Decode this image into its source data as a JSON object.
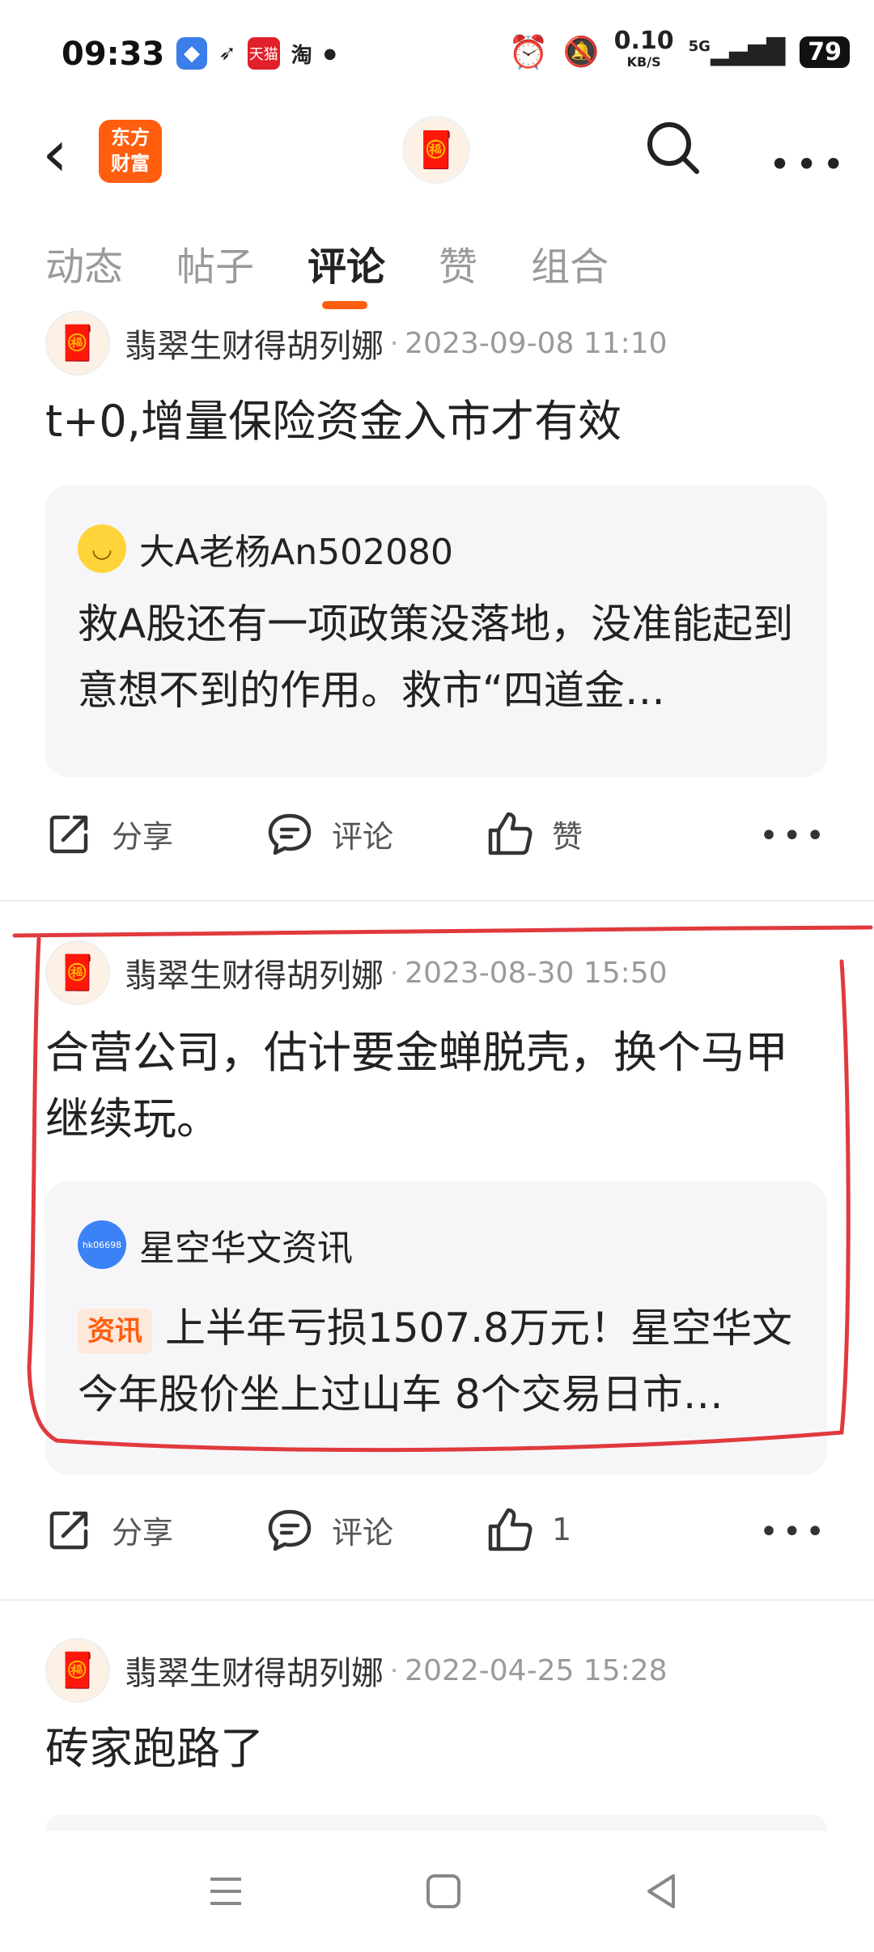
{
  "status_bar": {
    "time": "09:33",
    "app_icons": [
      "blue-app-icon",
      "bird-icon",
      "tmall-icon",
      "taobao-icon"
    ],
    "tmall_text": "天猫",
    "taobao_text": "淘",
    "net_speed_value": "0.10",
    "net_speed_unit": "KB/S",
    "network": "5G",
    "battery": "79"
  },
  "header": {
    "logo_line1": "东方",
    "logo_line2": "财富"
  },
  "tabs": [
    {
      "label": "动态",
      "active": false
    },
    {
      "label": "帖子",
      "active": false
    },
    {
      "label": "评论",
      "active": true
    },
    {
      "label": "赞",
      "active": false
    },
    {
      "label": "组合",
      "active": false
    }
  ],
  "posts": [
    {
      "author": "翡翠生财得胡列娜",
      "time": "2023-09-08 11:10",
      "text": "t+0,增量保险资金入市才有效",
      "quote": {
        "author": "大A老杨An502080",
        "badge": "",
        "text": "救A股还有一项政策没落地，没准能起到意想不到的作用。救市“四道金…"
      },
      "actions": {
        "share": "分享",
        "comment": "评论",
        "like": "赞"
      }
    },
    {
      "author": "翡翠生财得胡列娜",
      "time": "2023-08-30 15:50",
      "text": "合营公司，估计要金蝉脱壳，换个马甲继续玩。",
      "quote": {
        "author": "星空华文资讯",
        "avatar_text": "hk06698",
        "badge": "资讯",
        "text": "上半年亏损1507.8万元！星空华文今年股价坐上过山车 8个交易日市…"
      },
      "actions": {
        "share": "分享",
        "comment": "评论",
        "like": "1"
      }
    },
    {
      "author": "翡翠生财得胡列娜",
      "time": "2022-04-25 15:28",
      "text": "砖家跑路了"
    }
  ],
  "colors": {
    "brand": "#ff5e0f",
    "annotation": "#e03a3e"
  }
}
